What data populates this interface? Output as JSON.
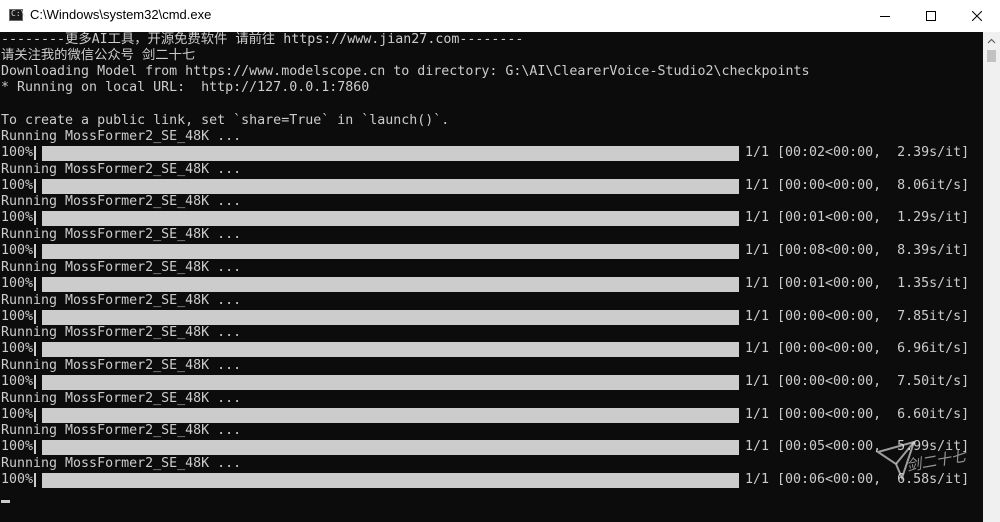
{
  "window": {
    "title": "C:\\Windows\\system32\\cmd.exe",
    "app_icon_glyph": "C:\\",
    "controls": [
      "minimize-icon",
      "maximize-icon",
      "close-icon"
    ]
  },
  "console": {
    "header_lines": [
      "--------更多AI工具，开源免费软件 请前往 https://www.jian27.com--------",
      "请关注我的微信公众号 剑二十七",
      "Downloading Model from https://www.modelscope.cn to directory: G:\\AI\\ClearerVoice-Studio2\\checkpoints",
      "* Running on local URL:  http://127.0.0.1:7860",
      "",
      "To create a public link, set `share=True` in `launch()`."
    ],
    "runs": [
      {
        "label": "Running MossFormer2_SE_48K ...",
        "percent": "100%",
        "progress": 1.0,
        "stats": "1/1 [00:02<00:00,  2.39s/it]"
      },
      {
        "label": "Running MossFormer2_SE_48K ...",
        "percent": "100%",
        "progress": 1.0,
        "stats": "1/1 [00:00<00:00,  8.06it/s]"
      },
      {
        "label": "Running MossFormer2_SE_48K ...",
        "percent": "100%",
        "progress": 1.0,
        "stats": "1/1 [00:01<00:00,  1.29s/it]"
      },
      {
        "label": "Running MossFormer2_SE_48K ...",
        "percent": "100%",
        "progress": 1.0,
        "stats": "1/1 [00:08<00:00,  8.39s/it]"
      },
      {
        "label": "Running MossFormer2_SE_48K ...",
        "percent": "100%",
        "progress": 1.0,
        "stats": "1/1 [00:01<00:00,  1.35s/it]"
      },
      {
        "label": "Running MossFormer2_SE_48K ...",
        "percent": "100%",
        "progress": 1.0,
        "stats": "1/1 [00:00<00:00,  7.85it/s]"
      },
      {
        "label": "Running MossFormer2_SE_48K ...",
        "percent": "100%",
        "progress": 1.0,
        "stats": "1/1 [00:00<00:00,  6.96it/s]"
      },
      {
        "label": "Running MossFormer2_SE_48K ...",
        "percent": "100%",
        "progress": 1.0,
        "stats": "1/1 [00:00<00:00,  7.50it/s]"
      },
      {
        "label": "Running MossFormer2_SE_48K ...",
        "percent": "100%",
        "progress": 1.0,
        "stats": "1/1 [00:00<00:00,  6.60it/s]"
      },
      {
        "label": "Running MossFormer2_SE_48K ...",
        "percent": "100%",
        "progress": 1.0,
        "stats": "1/1 [00:05<00:00,  5.99s/it]"
      },
      {
        "label": "Running MossFormer2_SE_48K ...",
        "percent": "100%",
        "progress": 1.0,
        "stats": "1/1 [00:06<00:00,  6.58s/it]"
      }
    ]
  },
  "watermark": {
    "text": "剑二十七"
  },
  "colors": {
    "console_bg": "#0c0c0c",
    "console_fg": "#cccccc",
    "titlebar_bg": "#ffffff"
  }
}
